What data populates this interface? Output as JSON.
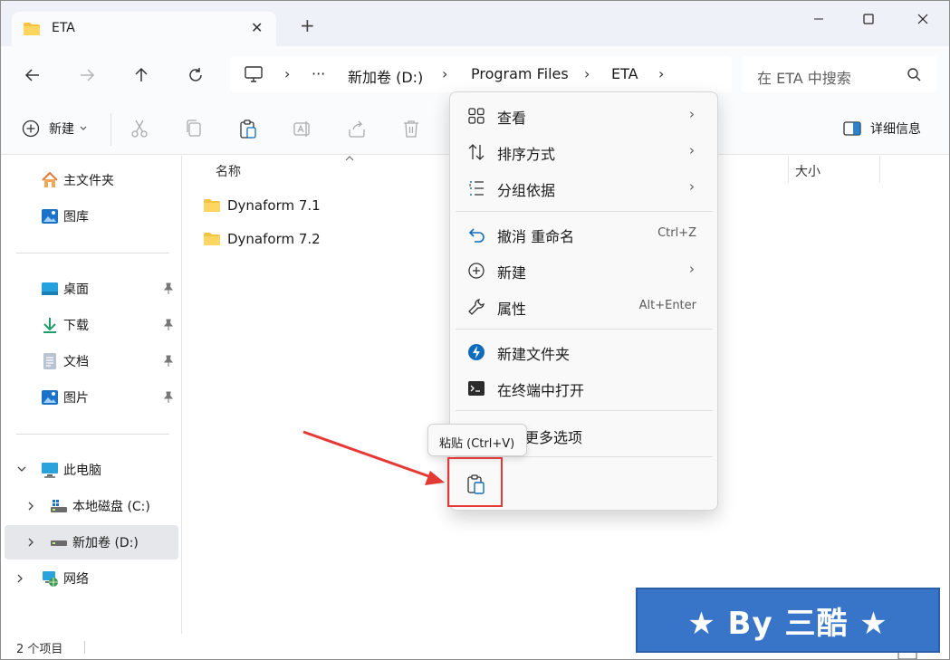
{
  "tab": {
    "title": "ETA",
    "close": "✕",
    "new": "+"
  },
  "window_controls": {
    "minimize": "─",
    "maximize": "☐",
    "close": "✕"
  },
  "address": {
    "more": "···",
    "crumbs": [
      "新加卷 (D:)",
      "Program Files",
      "ETA"
    ],
    "separator": "›"
  },
  "search": {
    "placeholder": "在 ETA 中搜索"
  },
  "toolbar": {
    "new_label": "新建",
    "details_label": "详细信息"
  },
  "sidebar": {
    "home": "主文件夹",
    "gallery": "图库",
    "desktop": "桌面",
    "downloads": "下载",
    "documents": "文档",
    "pictures": "图片",
    "this_pc": "此电脑",
    "drive_c": "本地磁盘 (C:)",
    "drive_d": "新加卷 (D:)",
    "network": "网络"
  },
  "columns": {
    "name": "名称",
    "size": "大小"
  },
  "files": [
    {
      "name": "Dynaform 7.1"
    },
    {
      "name": "Dynaform 7.2"
    }
  ],
  "status": {
    "count": "2 个项目"
  },
  "menu": {
    "view": "查看",
    "sort": "排序方式",
    "group": "分组依据",
    "undo": "撤消 重命名",
    "undo_key": "Ctrl+Z",
    "new": "新建",
    "properties": "属性",
    "properties_key": "Alt+Enter",
    "new_folder": "新建文件夹",
    "terminal": "在终端中打开",
    "more_options": "更多选项",
    "arrow": "›"
  },
  "tooltip": {
    "text": "粘贴 (Ctrl+V)"
  },
  "watermark": {
    "text": "★ By 三酷 ★"
  },
  "colors": {
    "accent": "#0f6cbd",
    "folder": "#f5c342",
    "highlight_red": "#e53935",
    "watermark_bg": "#3874c8"
  }
}
